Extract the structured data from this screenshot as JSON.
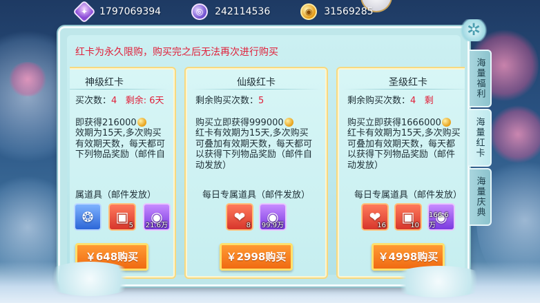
{
  "currencies": [
    {
      "icon": "purple-gem-icon",
      "glyph": "✦",
      "value": "1797069394"
    },
    {
      "icon": "purple-coin-icon",
      "glyph": "◎",
      "value": "242114536"
    },
    {
      "icon": "gold-coin-icon",
      "glyph": "◉",
      "value": "31569285"
    }
  ],
  "notice": "红卡为永久限购，购买完之后无法再次进行购买",
  "cards": [
    {
      "title": "神级红卡",
      "remain_label": "买次数：",
      "remain_count": "4",
      "days_label": "剩余: 6天",
      "desc_line1": "即获得216000",
      "desc_rest": "效期为15天,多次购买\n有效期天数，每天都可\n下列物品奖励（邮件自",
      "daily_label": "属道具（邮件发放）",
      "items": [
        {
          "icon": "blue-orb-icon",
          "glyph": "❂",
          "color": "blue",
          "qty": ""
        },
        {
          "icon": "treasure-chest-icon",
          "glyph": "▣",
          "color": "red",
          "qty": "5"
        },
        {
          "icon": "purple-coin-icon",
          "glyph": "◉",
          "color": "purple",
          "qty": "21.6万"
        }
      ],
      "buy_label": "￥648购买"
    },
    {
      "title": "仙级红卡",
      "remain_label": "剩余购买次数：",
      "remain_count": "5",
      "days_label": "",
      "desc_line1": "购买立即获得999000",
      "desc_rest": "红卡有效期为15天,多次购买\n可叠加有效期天数，每天都可\n以获得下列物品奖励（邮件自\n动发放）",
      "daily_label": "每日专属道具（邮件发放）",
      "items": [
        {
          "icon": "red-gem-icon",
          "glyph": "❤",
          "color": "red",
          "qty": "8"
        },
        {
          "icon": "purple-coin-icon",
          "glyph": "◉",
          "color": "purple",
          "qty": "99.9万"
        }
      ],
      "buy_label": "￥2998购买"
    },
    {
      "title": "圣级红卡",
      "remain_label": "剩余购买次数：",
      "remain_count": "4",
      "days_label": "剩",
      "desc_line1": "购买立即获得1666000",
      "desc_rest": "红卡有效期为15天,多次购买\n可叠加有效期天数，每天都\n以获得下列物品奖励（邮件\n动发放）",
      "daily_label": "每日专属道具（邮件发放）",
      "items": [
        {
          "icon": "red-gem-icon",
          "glyph": "❤",
          "color": "red",
          "qty": "16"
        },
        {
          "icon": "treasure-chest-icon",
          "glyph": "▣",
          "color": "red",
          "qty": "10"
        },
        {
          "icon": "purple-coin-icon",
          "glyph": "◉",
          "color": "purple",
          "qty": "166.6万"
        }
      ],
      "buy_label": "￥4998购买"
    }
  ],
  "side_tabs": [
    {
      "label": "海量福利",
      "active": false
    },
    {
      "label": "海量红卡",
      "active": true
    },
    {
      "label": "海量庆典",
      "active": false
    }
  ],
  "colors": {
    "notice_red": "#e0203a",
    "panel": "#bfe7ea",
    "buy_orange": "#f06a12"
  }
}
